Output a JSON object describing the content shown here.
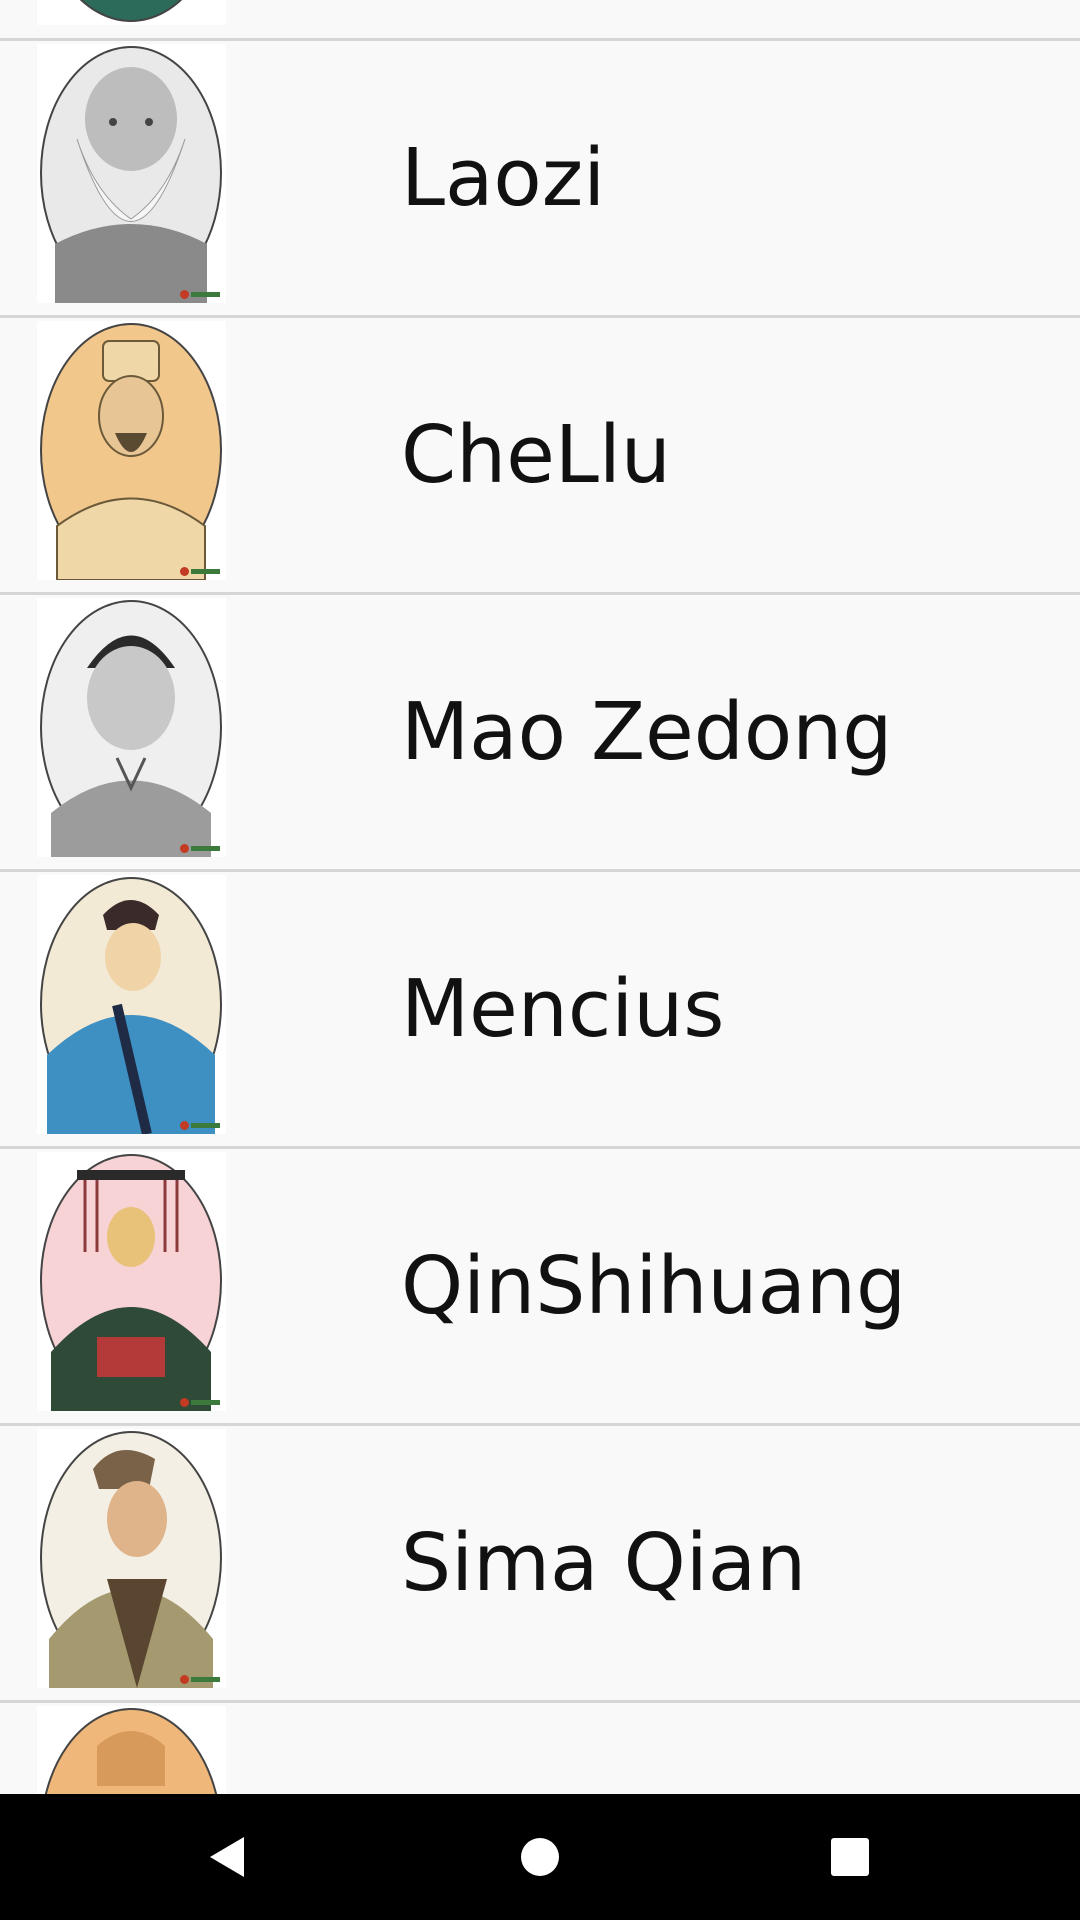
{
  "list": {
    "items": [
      {
        "label": "Laozi",
        "portrait": "laozi-portrait",
        "bg": "#e9e9e9",
        "robe": "#d9d9d9",
        "face": "#bdbdbd"
      },
      {
        "label": "CheLlu",
        "portrait": "chellu-portrait",
        "bg": "#f2c78c",
        "robe": "#f0d7a8",
        "face": "#e8c594"
      },
      {
        "label": "Mao Zedong",
        "portrait": "mao-zedong-portrait",
        "bg": "#efefef",
        "robe": "#9c9c9c",
        "face": "#c8c8c8"
      },
      {
        "label": "Mencius",
        "portrait": "mencius-portrait",
        "bg": "#f3ead6",
        "robe": "#3e8fc2",
        "face": "#f0d4a8"
      },
      {
        "label": "QinShihuang",
        "portrait": "qinshihuang-portrait",
        "bg": "#f7d3d6",
        "robe": "#2f4a36",
        "face": "#e9c27a"
      },
      {
        "label": "Sima Qian",
        "portrait": "sima-qian-portrait",
        "bg": "#f4efe4",
        "robe": "#a59a6f",
        "face": "#dfb48a"
      }
    ]
  },
  "navbar": {
    "back": "back-icon",
    "home": "home-icon",
    "recents": "recents-icon"
  },
  "colors": {
    "background": "#f9f9f9",
    "divider": "#d6d6d6",
    "text": "#111111",
    "navbar": "#000000",
    "nav_icons": "#ffffff"
  }
}
